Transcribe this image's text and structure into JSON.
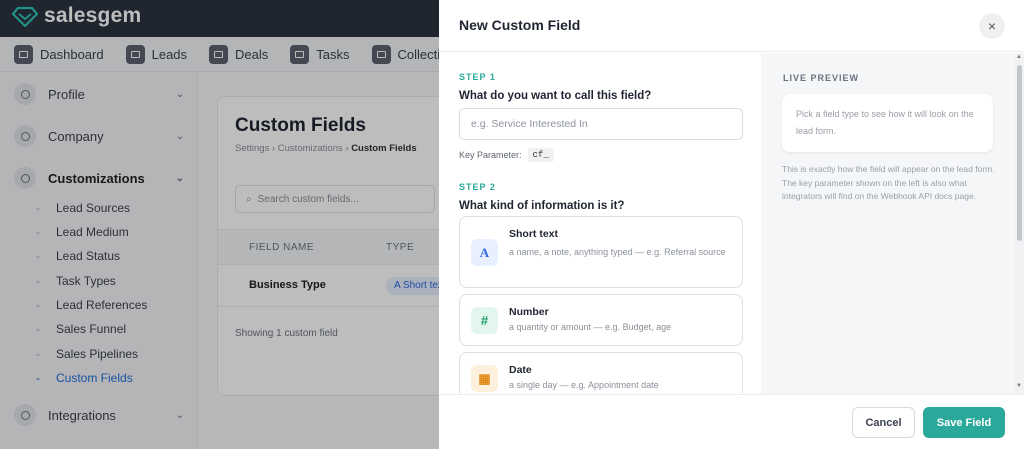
{
  "app": {
    "brand": "salesgem"
  },
  "nav": [
    {
      "label": "Dashboard",
      "icon": "dashboard-icon"
    },
    {
      "label": "Leads",
      "icon": "leads-icon"
    },
    {
      "label": "Deals",
      "icon": "deals-icon"
    },
    {
      "label": "Tasks",
      "icon": "tasks-icon"
    },
    {
      "label": "Collection",
      "icon": "collection-icon"
    }
  ],
  "sidebar": {
    "sections": [
      {
        "label": "Profile",
        "icon": "user-icon"
      },
      {
        "label": "Company",
        "icon": "building-icon"
      },
      {
        "label": "Customizations",
        "icon": "fingerprint-icon"
      },
      {
        "label": "Integrations",
        "icon": "puzzle-icon"
      }
    ],
    "sub_items": [
      "Lead Sources",
      "Lead Medium",
      "Lead Status",
      "Task Types",
      "Lead References",
      "Sales Funnel",
      "Sales Pipelines",
      "Custom Fields"
    ]
  },
  "page": {
    "title": "Custom Fields",
    "breadcrumb": {
      "a": "Settings",
      "b": "Customizations",
      "current": "Custom Fields"
    },
    "search_placeholder": "Search custom fields...",
    "columns": {
      "name": "FIELD NAME",
      "type": "TYPE"
    },
    "rows": [
      {
        "name": "Business Type",
        "type": "Short text"
      }
    ],
    "footer": "Showing 1 custom field"
  },
  "modal": {
    "title": "New Custom Field",
    "close": "×",
    "step1": {
      "label": "STEP 1",
      "question": "What do you want to call this field?",
      "placeholder": "e.g. Service Interested In",
      "value": "",
      "key_label": "Key Parameter:",
      "key_value": "cf_"
    },
    "step2": {
      "label": "STEP 2",
      "question": "What kind of information is it?",
      "options": [
        {
          "name": "Short text",
          "desc": "a name, a note, anything typed — e.g. Referral source",
          "glyph": "A",
          "icon": "text-type-icon",
          "color": "#2c6ae0",
          "bg": "#e8efff"
        },
        {
          "name": "Number",
          "desc": "a quantity or amount — e.g. Budget, age",
          "glyph": "#",
          "icon": "hash-icon",
          "color": "#1f9d6a",
          "bg": "#e3f6ee"
        },
        {
          "name": "Date",
          "desc": "a single day — e.g. Appointment date",
          "glyph": "▦",
          "icon": "calendar-icon",
          "color": "#e08a14",
          "bg": "#fdf0dd"
        }
      ]
    },
    "preview": {
      "label": "LIVE PREVIEW",
      "placeholder": "Pick a field type to see how it will look on the lead form.",
      "note": "This is exactly how the field will appear on the lead form. The key parameter shown on the left is also what integrators will find on the Webhook API docs page."
    },
    "cancel_label": "Cancel",
    "save_label": "Save Field"
  },
  "colors": {
    "accent": "#2aa899",
    "topbar": "#2b3440",
    "link": "#1e6fd9"
  }
}
